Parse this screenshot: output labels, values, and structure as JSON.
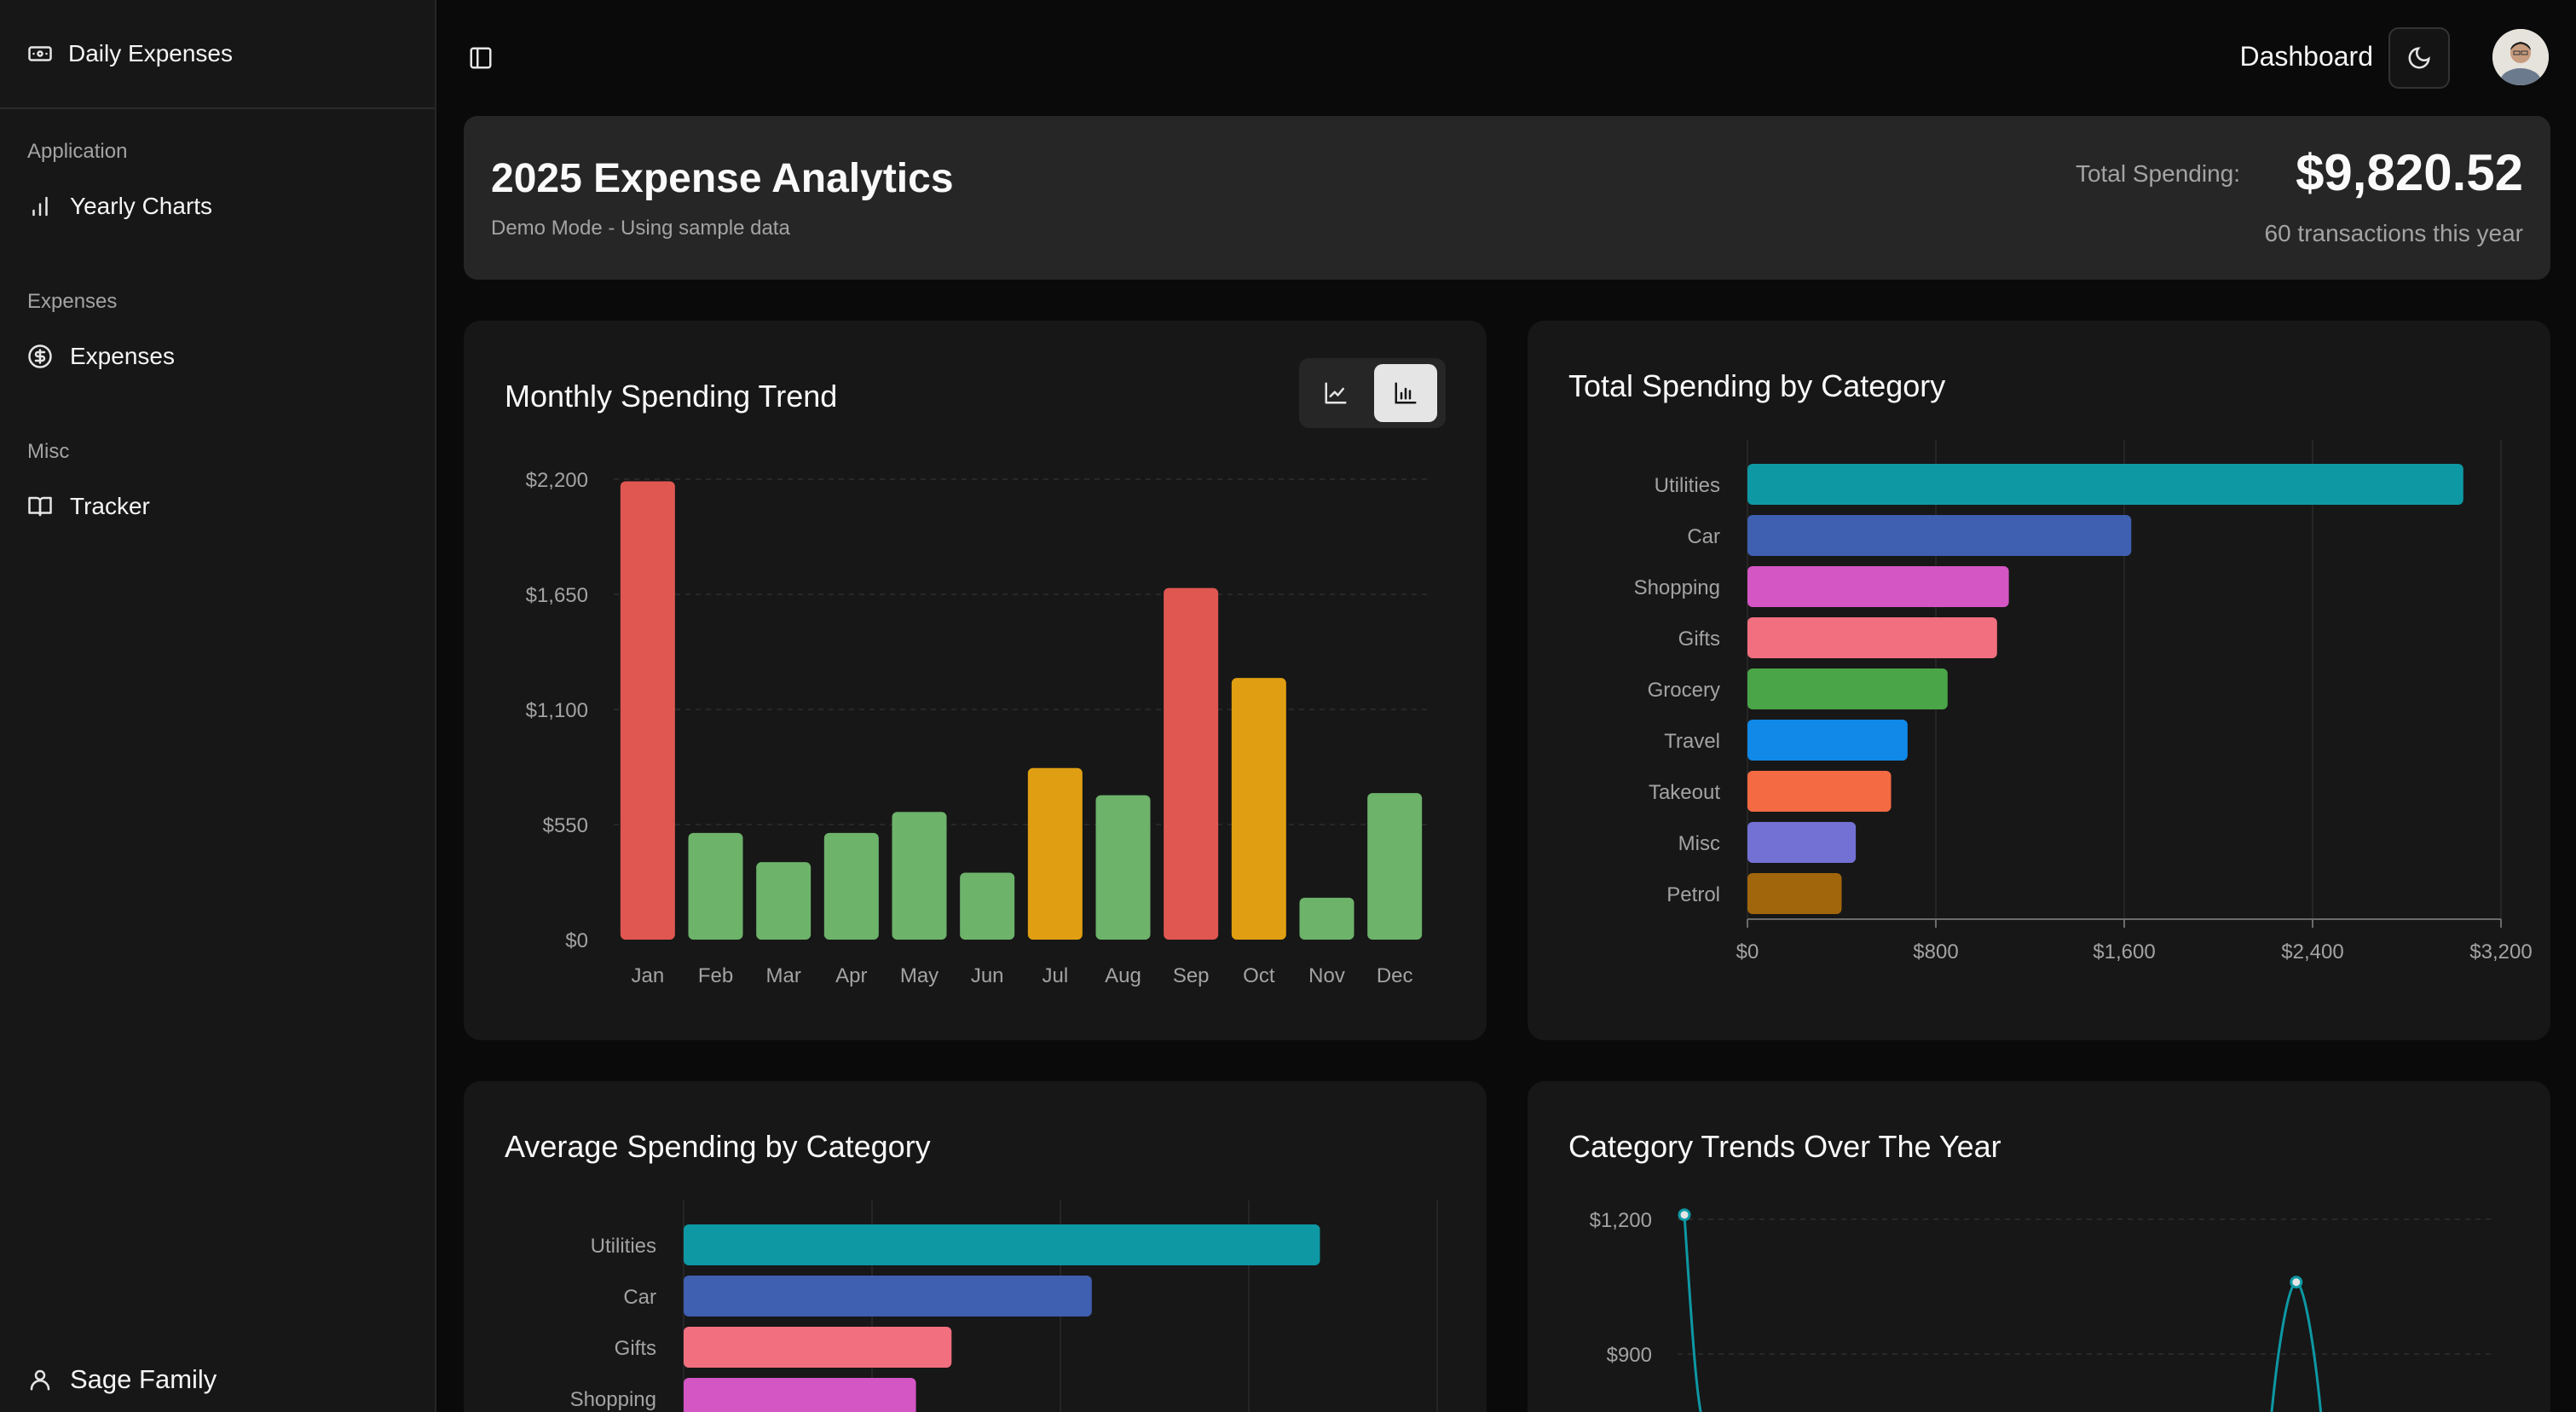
{
  "sidebar": {
    "brand": "Daily Expenses",
    "groups": [
      {
        "label": "Application",
        "item": "Yearly Charts"
      },
      {
        "label": "Expenses",
        "item": "Expenses"
      },
      {
        "label": "Misc",
        "item": "Tracker"
      }
    ],
    "user": "Sage Family"
  },
  "topbar": {
    "title": "Dashboard"
  },
  "header": {
    "title": "2025 Expense Analytics",
    "subtitle": "Demo Mode - Using sample data",
    "total_label": "Total Spending:",
    "total_value": "$9,820.52",
    "transactions": "60 transactions this year"
  },
  "colors": {
    "red": "#e05751",
    "green": "#6db36a",
    "orange": "#e09f12",
    "teal": "#0d98a4",
    "blue": "#3f5fb0",
    "magenta": "#d455c4",
    "pink": "#f26f7f",
    "grocery_green": "#4aa548",
    "sky": "#1089e8",
    "coral": "#f36a43",
    "lavender": "#7371d4",
    "brown": "#a1660b"
  },
  "chart_data": [
    {
      "type": "bar",
      "title": "Monthly Spending Trend",
      "categories": [
        "Jan",
        "Feb",
        "Mar",
        "Apr",
        "May",
        "Jun",
        "Jul",
        "Aug",
        "Sep",
        "Oct",
        "Nov",
        "Dec"
      ],
      "values": [
        2190,
        510,
        370,
        510,
        610,
        320,
        820,
        690,
        1680,
        1250,
        200,
        700
      ],
      "colors": [
        "red",
        "green",
        "green",
        "green",
        "green",
        "green",
        "orange",
        "green",
        "red",
        "orange",
        "green",
        "green"
      ],
      "ylim": [
        0,
        2200
      ],
      "yticks": [
        "$0",
        "$550",
        "$1,100",
        "$1,650",
        "$2,200"
      ],
      "view_modes": [
        "line-chart-icon",
        "bar-chart-icon"
      ],
      "active_mode": "bar"
    },
    {
      "type": "bar",
      "orientation": "horizontal",
      "title": "Total Spending by Category",
      "categories": [
        "Utilities",
        "Car",
        "Shopping",
        "Gifts",
        "Grocery",
        "Travel",
        "Takeout",
        "Misc",
        "Petrol"
      ],
      "values": [
        3040,
        1630,
        1110,
        1060,
        850,
        680,
        610,
        460,
        400
      ],
      "colors": [
        "teal",
        "blue",
        "magenta",
        "pink",
        "grocery_green",
        "sky",
        "coral",
        "lavender",
        "brown"
      ],
      "xlim": [
        0,
        3200
      ],
      "xticks": [
        "$0",
        "$800",
        "$1,600",
        "$2,400",
        "$3,200"
      ]
    },
    {
      "type": "bar",
      "orientation": "horizontal",
      "title": "Average Spending by Category",
      "categories": [
        "Utilities",
        "Car",
        "Gifts",
        "Shopping"
      ],
      "values": [
        3040,
        1950,
        1280,
        1110
      ],
      "colors": [
        "teal",
        "blue",
        "pink",
        "magenta"
      ],
      "xlim": [
        0,
        3600
      ]
    },
    {
      "type": "line",
      "title": "Category Trends Over The Year",
      "yticks": [
        "$900",
        "$1,200"
      ],
      "series": [
        {
          "color": "teal",
          "x": [
            0,
            8.4
          ],
          "peak_values": [
            1210,
            1060
          ]
        }
      ]
    }
  ]
}
